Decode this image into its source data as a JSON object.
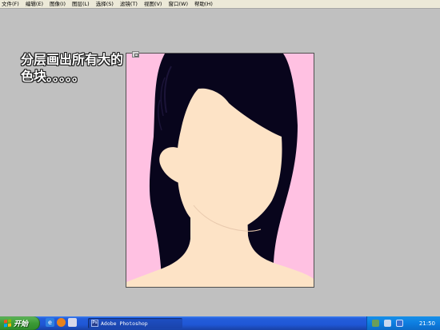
{
  "menu": {
    "items": [
      {
        "label": "文件(F)"
      },
      {
        "label": "编辑(E)"
      },
      {
        "label": "图像(I)"
      },
      {
        "label": "图层(L)"
      },
      {
        "label": "选择(S)"
      },
      {
        "label": "滤镜(T)"
      },
      {
        "label": "视图(V)"
      },
      {
        "label": "窗口(W)"
      },
      {
        "label": "帮助(H)"
      }
    ]
  },
  "annotation": {
    "line1": "分层画出所有大的",
    "line2": "色块。。。。。"
  },
  "canvas": {
    "background_color": "#ffc1e2",
    "hair_color": "#08051c",
    "skin_color": "#fde3c6"
  },
  "taskbar": {
    "start_label": "开始",
    "task_label": "Adobe Photoshop",
    "task_icon": "photoshop-icon",
    "clock": "21:50",
    "quick_launch_icons": [
      "ie-icon",
      "firefox-icon",
      "media-player-icon"
    ],
    "tray_icons": [
      "network-icon",
      "volume-icon",
      "language-icon"
    ]
  }
}
